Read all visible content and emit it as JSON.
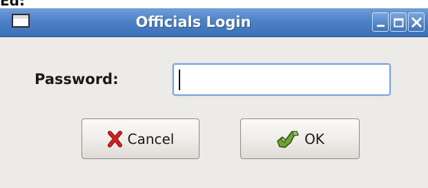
{
  "window": {
    "title": "Officials Login",
    "controls": {
      "minimize": "minimize-icon",
      "maximize": "maximize-icon",
      "close": "close-icon"
    }
  },
  "form": {
    "password_label": "Password:",
    "password_value": ""
  },
  "buttons": {
    "cancel_label": "Cancel",
    "cancel_icon": "red-x-icon",
    "ok_label": "OK",
    "ok_icon": "green-check-hand-icon"
  },
  "colors": {
    "titlebar": "#4d82c8",
    "window_bg": "#edebe7",
    "input_focus_border": "#7ea3d6",
    "cancel_icon": "#cc1a1a",
    "ok_icon": "#5e8f2f"
  }
}
